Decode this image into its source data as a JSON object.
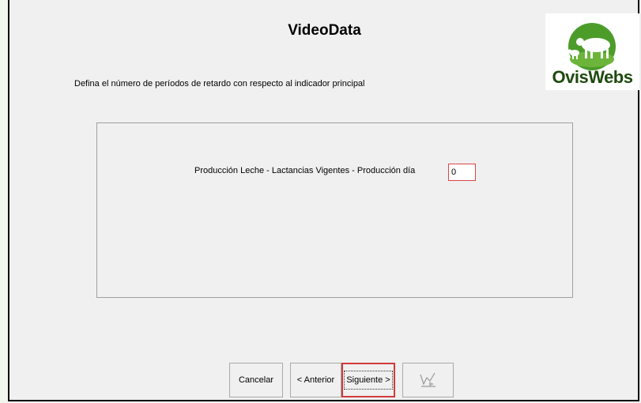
{
  "window": {
    "title": "VideoData",
    "logo_text": "OvisWebs"
  },
  "main": {
    "instruction": "Defina el número de períodos de retardo con respecto al indicador principal",
    "field_label": "Producción Leche - Lactancias Vigentes - Producción día",
    "field_value": "0"
  },
  "buttons": {
    "cancel": "Cancelar",
    "previous": "< Anterior",
    "next": "Siguiente >"
  },
  "icons": {
    "video": "video-chart-icon",
    "logo": "sheep-logo-icon"
  },
  "colors": {
    "focus_border": "#d23a3a",
    "logo_green": "#3f8f22"
  }
}
